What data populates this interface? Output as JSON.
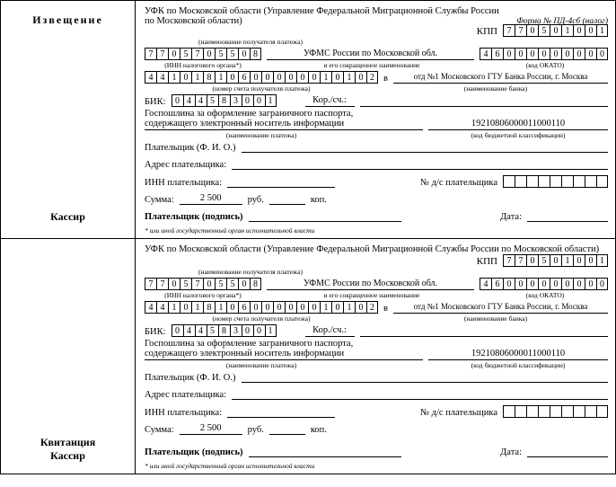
{
  "form_code": "Форма № ПД-4сб (налог)",
  "recipient": "УФК по Московской области (Управление Федеральной Миграционной Службы России по Московской области)",
  "kpp_label": "КПП",
  "kpp": [
    "7",
    "7",
    "0",
    "5",
    "0",
    "1",
    "0",
    "0",
    "1"
  ],
  "inn": [
    "7",
    "7",
    "0",
    "5",
    "7",
    "0",
    "5",
    "5",
    "0",
    "8"
  ],
  "recipient_short": "УФМС России по Московской обл.",
  "okato": [
    "4",
    "6",
    "0",
    "0",
    "0",
    "0",
    "0",
    "0",
    "0",
    "0",
    "0"
  ],
  "account": [
    "4",
    "4",
    "1",
    "0",
    "1",
    "8",
    "1",
    "0",
    "6",
    "0",
    "0",
    "0",
    "0",
    "0",
    "0",
    "1",
    "0",
    "1",
    "0",
    "2"
  ],
  "bank_prefix": "в",
  "bank": "отд №1 Московского ГТУ Банка России, г. Москва",
  "bik_label": "БИК:",
  "bik": [
    "0",
    "4",
    "4",
    "5",
    "8",
    "3",
    "0",
    "0",
    "1"
  ],
  "korr_label": "Кор./сч.:",
  "purpose_l1": "Госпошлина за оформление заграничного паспорта,",
  "purpose_l2": "содержащего электронный носитель информации",
  "kbk": "19210806000011000110",
  "payer_label": "Плательщик (Ф. И. О.)",
  "addr_label": "Адрес плательщика:",
  "inn_payer_label": "ИНН плательщика:",
  "doc_no_label": "№ д/с плательщика",
  "sum_label": "Сумма:",
  "sum_value": "2 500",
  "rub": "руб.",
  "kop": "коп.",
  "sign_label": "Плательщик (подпись)",
  "date_label": "Дата:",
  "footnote": "* или иной государственный орган исполнительной власти",
  "captions": {
    "recipient": "(наименование получателя платежа)",
    "inn": "(ИНН налогового органа*)",
    "short": "и его сокращенное наименование",
    "okato": "(код ОКАТО)",
    "account": "(номер счета получателя платежа)",
    "bank": "(наименование банка)",
    "purpose": "(наименование платежа)",
    "kbk": "(код бюджетной классификации)"
  },
  "side": {
    "notice": "Извещение",
    "cashier": "Кассир",
    "receipt": "Квитанция"
  }
}
